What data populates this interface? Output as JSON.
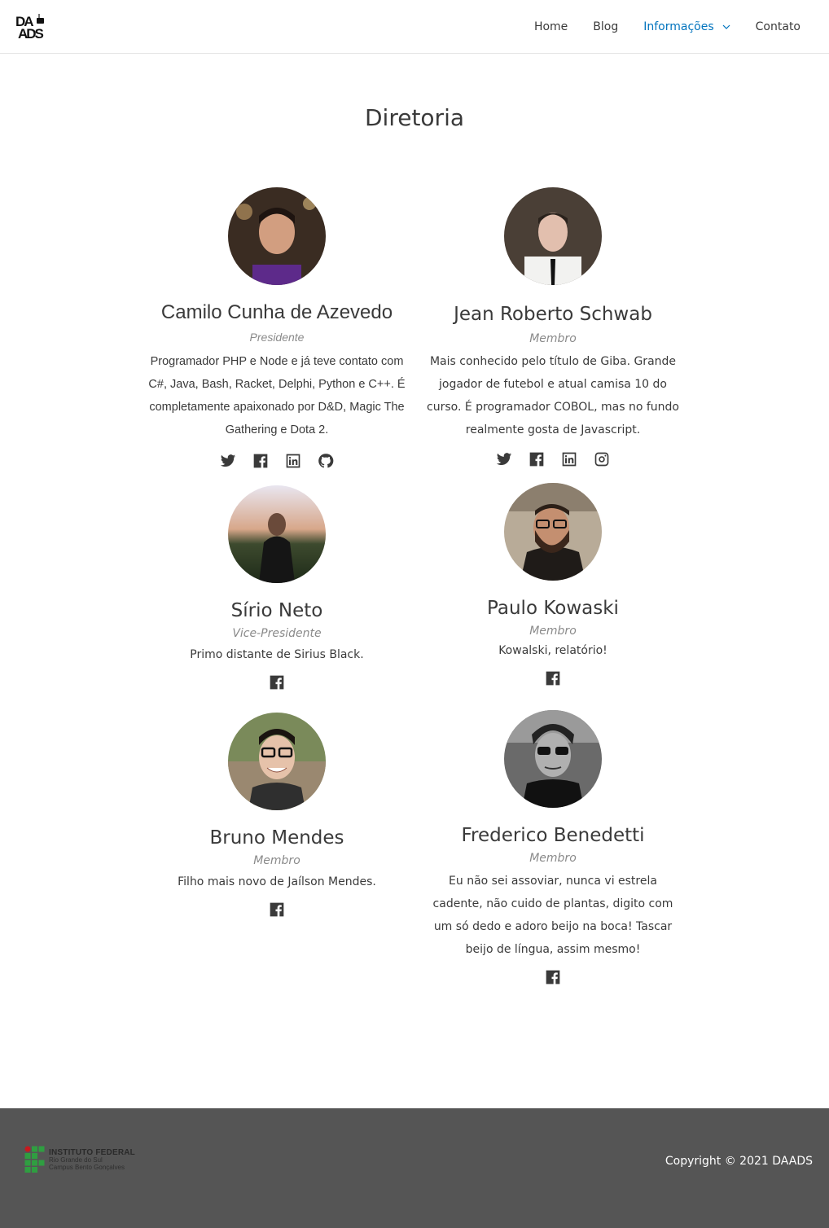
{
  "header": {
    "logo_alt": "DAADS",
    "nav": [
      {
        "label": "Home"
      },
      {
        "label": "Blog"
      },
      {
        "label": "Informações"
      },
      {
        "label": "Contato"
      }
    ]
  },
  "page": {
    "title": "Diretoria"
  },
  "members": [
    {
      "name": "Camilo Cunha de Azevedo",
      "role": "Presidente",
      "bio": "Programador PHP e Node e já teve contato com C#, Java, Bash, Racket, Delphi, Python e C++. É completamente apaixonado por D&D, Magic The Gathering e Dota 2.",
      "socials": [
        "twitter-icon",
        "facebook-icon",
        "linkedin-icon",
        "github-icon"
      ]
    },
    {
      "name": "Jean Roberto Schwab",
      "role": "Membro",
      "bio": "Mais conhecido pelo título de Giba. Grande jogador de futebol e atual camisa 10 do curso. É programador COBOL, mas no fundo realmente gosta de Javascript.",
      "socials": [
        "twitter-icon",
        "facebook-icon",
        "linkedin-icon",
        "instagram-icon"
      ]
    },
    {
      "name": "Sírio Neto",
      "role": "Vice-Presidente",
      "bio": "Primo distante de Sirius Black.",
      "socials": [
        "facebook-icon"
      ]
    },
    {
      "name": "Paulo Kowaski",
      "role": "Membro",
      "bio": "Kowalski, relatório!",
      "socials": [
        "facebook-icon"
      ]
    },
    {
      "name": "Bruno Mendes",
      "role": "Membro",
      "bio": "Filho mais novo de Jaílson Mendes.",
      "socials": [
        "facebook-icon"
      ]
    },
    {
      "name": "Frederico Benedetti",
      "role": "Membro",
      "bio": "Eu não sei assoviar, nunca vi estrela cadente, não cuido de plantas, digito com um só dedo e adoro beijo na boca! Tascar beijo de língua, assim mesmo!",
      "socials": [
        "facebook-icon"
      ]
    }
  ],
  "footer": {
    "institution": {
      "line1": "INSTITUTO FEDERAL",
      "line2": "Rio Grande do Sul",
      "line3": "Campus Bento Gonçalves"
    },
    "copyright": "Copyright © 2021 DAADS"
  },
  "colors": {
    "accent": "#0274be",
    "text": "#3a3a3a",
    "muted": "#8a8a8a",
    "footer_bg": "#555555",
    "if_green": "#2f9e41",
    "if_red": "#c8191e"
  }
}
